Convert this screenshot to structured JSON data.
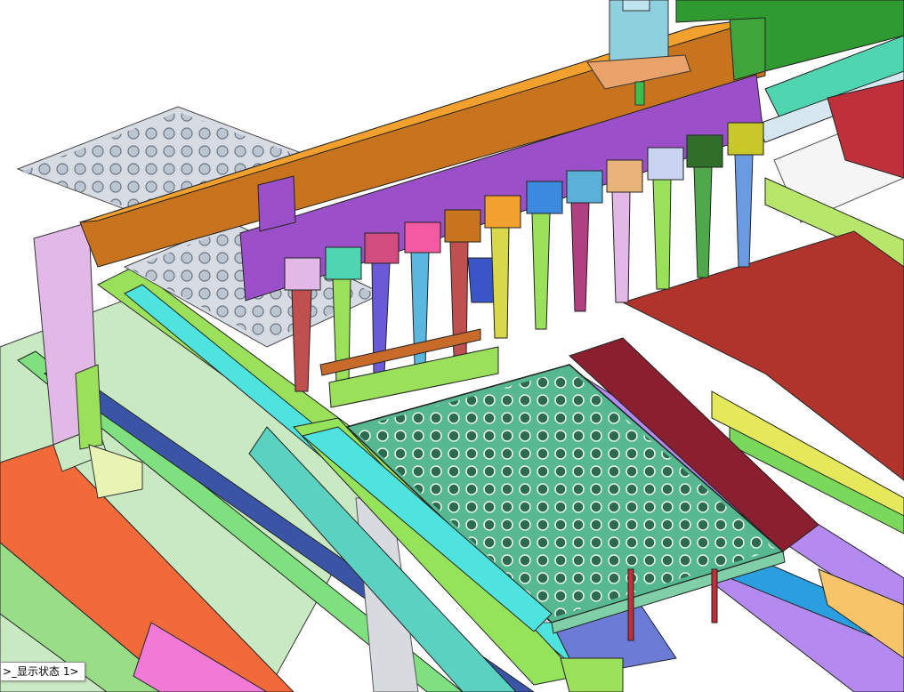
{
  "viewport": {
    "configuration_tag": ">_显示状态 1>"
  },
  "colors": {
    "beam_orange": "#c8741e",
    "beam_top": "#f2a12e",
    "purple_plate": "#9b4fc8",
    "dark_red_panel": "#b0342c",
    "light_green_rail": "#9be05a",
    "cyan_rail": "#4fe3e0",
    "lavender_post": "#e2b8e6",
    "tray_green": "#56b891"
  },
  "icons": {
    "ghost_hole": "hole-icon",
    "cylinder": "cylinder-icon"
  }
}
